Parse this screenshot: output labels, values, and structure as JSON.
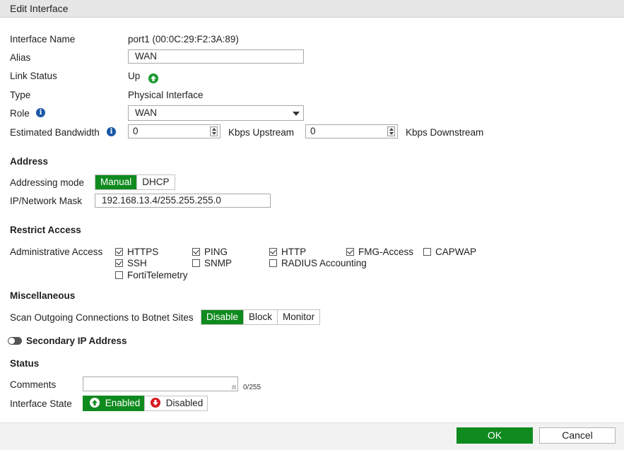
{
  "title": "Edit Interface",
  "fields": {
    "interface_name_label": "Interface Name",
    "interface_name_value": "port1 (00:0C:29:F2:3A:89)",
    "alias_label": "Alias",
    "alias_value": "WAN",
    "link_status_label": "Link Status",
    "link_status_value": "Up",
    "type_label": "Type",
    "type_value": "Physical Interface",
    "role_label": "Role",
    "role_value": "WAN",
    "bandwidth_label": "Estimated Bandwidth",
    "upstream_value": "0",
    "upstream_unit": "Kbps Upstream",
    "downstream_value": "0",
    "downstream_unit": "Kbps Downstream"
  },
  "address": {
    "heading": "Address",
    "mode_label": "Addressing mode",
    "modes": [
      "Manual",
      "DHCP"
    ],
    "selected_mode": "Manual",
    "ip_label": "IP/Network Mask",
    "ip_value": "192.168.13.4/255.255.255.0"
  },
  "restrict": {
    "heading": "Restrict Access",
    "admin_label": "Administrative Access",
    "options": [
      {
        "label": "HTTPS",
        "checked": true
      },
      {
        "label": "PING",
        "checked": true
      },
      {
        "label": "HTTP",
        "checked": true
      },
      {
        "label": "FMG-Access",
        "checked": true
      },
      {
        "label": "CAPWAP",
        "checked": false
      },
      {
        "label": "SSH",
        "checked": true
      },
      {
        "label": "SNMP",
        "checked": false
      },
      {
        "label": "RADIUS Accounting",
        "checked": false
      },
      {
        "label": "FortiTelemetry",
        "checked": false
      }
    ]
  },
  "misc": {
    "heading": "Miscellaneous",
    "botnet_label": "Scan Outgoing Connections to Botnet Sites",
    "botnet_options": [
      "Disable",
      "Block",
      "Monitor"
    ],
    "botnet_selected": "Disable"
  },
  "secondary": {
    "label": "Secondary IP Address",
    "enabled": false
  },
  "status": {
    "heading": "Status",
    "comments_label": "Comments",
    "comments_value": "",
    "comments_counter": "0/255",
    "state_label": "Interface State",
    "enabled_label": "Enabled",
    "disabled_label": "Disabled",
    "selected_state": "Enabled"
  },
  "footer": {
    "ok_label": "OK",
    "cancel_label": "Cancel"
  },
  "colors": {
    "accent_green": "#0f8a1e",
    "info_blue": "#1a56a6",
    "disabled_red": "#d71920"
  }
}
